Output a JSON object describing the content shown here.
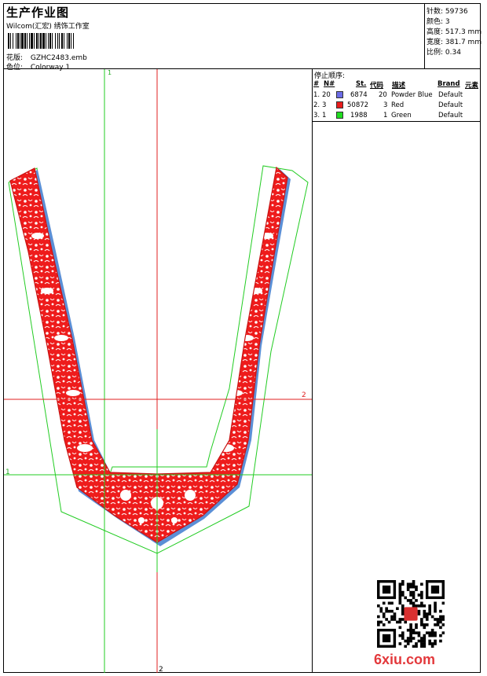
{
  "header": {
    "title": "生产作业图",
    "subtitle": "Wilcom(汇宏) 绣饰工作室",
    "design_label": "花版:",
    "design_value": "GZHC2483.emb",
    "colorway_label": "色位:",
    "colorway_value": "Colorway 1"
  },
  "stats": [
    {
      "label": "针数:",
      "value": "59736"
    },
    {
      "label": "颜色:",
      "value": "3"
    },
    {
      "label": "高度:",
      "value": "517.3 mm"
    },
    {
      "label": "宽度:",
      "value": "381.7 mm"
    },
    {
      "label": "比例:",
      "value": "0.34"
    }
  ],
  "stop_sequence": {
    "title": "停止顺序:",
    "columns": [
      "#",
      "N#",
      "St.",
      "代码",
      "描述",
      "Brand",
      "元素"
    ],
    "rows": [
      {
        "idx": "1.",
        "n": "20",
        "color": "#6c6ce6",
        "stitches": "6874",
        "code": "20",
        "desc": "Powder Blue",
        "brand": "Default"
      },
      {
        "idx": "2.",
        "n": "3",
        "color": "#e81c1c",
        "stitches": "50872",
        "code": "3",
        "desc": "Red",
        "brand": "Default"
      },
      {
        "idx": "3.",
        "n": "1",
        "color": "#20dc20",
        "stitches": "1988",
        "code": "1",
        "desc": "Green",
        "brand": "Default"
      }
    ]
  },
  "guides": {
    "v1_label": "1",
    "h2_label": "2",
    "h1_label": "1",
    "v2_label": "2"
  },
  "watermark": "6xiu.com",
  "colors": {
    "embroidery_red": "#ee1c1c",
    "outline_blue": "#5b8fd6",
    "bbox_green": "#22cc22",
    "guide_red": "#e02020"
  }
}
